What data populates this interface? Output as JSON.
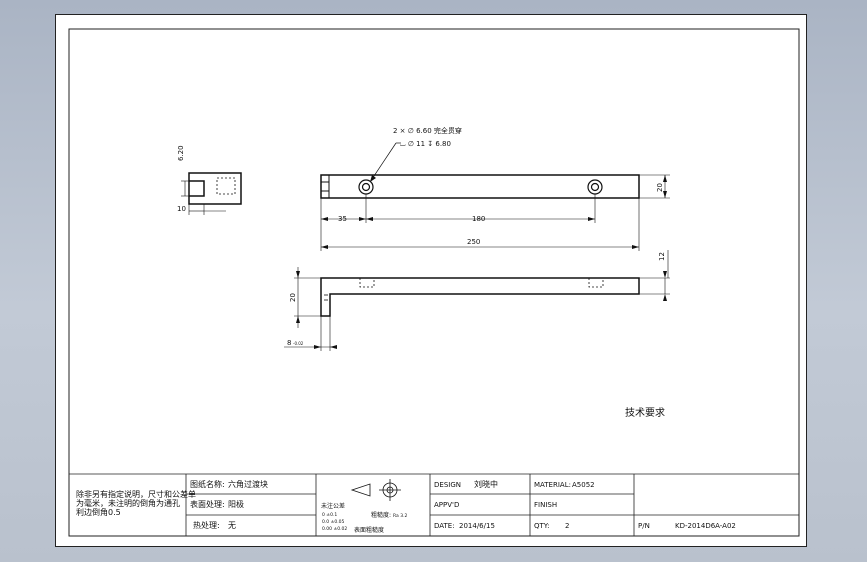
{
  "dimensions": {
    "hole_callout_line1": "2 × ∅ 6.60 完全贯穿",
    "hole_callout_line2": "⌴ ∅ 11 ↧ 6.80",
    "side_height": "6.20",
    "side_width": "10",
    "part_height": "20",
    "dist_hole_first": "35",
    "dist_holes": "180",
    "overall_length": "250",
    "bottom_thickness": "12",
    "bottom_leg_height": "20",
    "bottom_leg_width": "8",
    "bottom_leg_tol": "-0.02"
  },
  "notes": {
    "technical_requirements": "技术要求"
  },
  "title_block": {
    "general_note_line1": "除非另有指定说明，尺寸和公差单",
    "general_note_line2": "为毫米，未注明的倒角为通孔",
    "general_note_line3": "利边倒角0.5",
    "drawing_name_label": "图纸名称:",
    "drawing_name_value": "六角过渡块",
    "surface_treatment_label": "表面处理:",
    "surface_treatment_value": "阳极",
    "heat_treatment_label": "热处理:",
    "heat_treatment_value": "无",
    "tolerance_label": "未注公差",
    "tol_row1": "0    ±0.1",
    "tol_row2": "0.0  ±0.05",
    "tol_row3": "0.00 ±0.02",
    "roughness_label": "粗糙度:",
    "roughness_value": "Ra 3.2",
    "surface_roughness_label": "表面粗糙度",
    "design_label": "DESIGN",
    "design_value": "刘晓中",
    "appvd_label": "APPV'D",
    "appvd_value": "",
    "date_label": "DATE:",
    "date_value": "2014/6/15",
    "material_label": "MATERIAL:",
    "material_value": "A5052",
    "finish_label": "FINISH",
    "finish_value": "",
    "qty_label": "QTY:",
    "qty_value": "2",
    "pn_label": "P/N",
    "pn_value": "KD-2014D6A-A02"
  }
}
